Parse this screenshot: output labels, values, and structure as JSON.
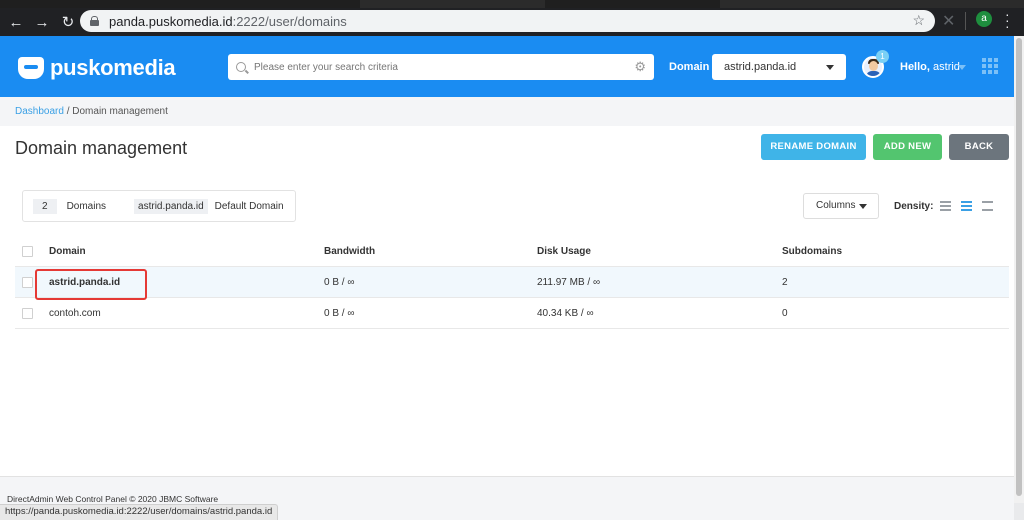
{
  "browser": {
    "url_host": "panda.puskomedia.id",
    "url_rest": ":2222/user/domains",
    "profile_initial": "a"
  },
  "header": {
    "logo_text": "puskomedia",
    "search_placeholder": "Please enter your search criteria",
    "domain_label": "Domain",
    "domain_selected": "astrid.panda.id",
    "notification_count": "1",
    "hello_prefix": "Hello,",
    "username": "astrid",
    "brand_color": "#1a8cf2"
  },
  "breadcrumb": {
    "root": "Dashboard",
    "separator": "/",
    "current": "Domain management"
  },
  "page": {
    "title": "Domain management",
    "buttons": {
      "rename": "RENAME DOMAIN",
      "add_new": "ADD NEW",
      "back": "BACK"
    }
  },
  "summary": {
    "count": "2",
    "count_label": "Domains",
    "default_domain": "astrid.panda.id",
    "default_label": "Default Domain"
  },
  "controls": {
    "columns_label": "Columns",
    "density_label": "Density:"
  },
  "table": {
    "headers": [
      "Domain",
      "Bandwidth",
      "Disk Usage",
      "Subdomains"
    ],
    "rows": [
      {
        "domain": "astrid.panda.id",
        "bandwidth": "0 B / ∞",
        "disk": "211.97 MB / ∞",
        "subdomains": "2"
      },
      {
        "domain": "contoh.com",
        "bandwidth": "0 B / ∞",
        "disk": "40.34 KB / ∞",
        "subdomains": "0"
      }
    ]
  },
  "footer": {
    "text": "DirectAdmin Web Control Panel © 2020 JBMC Software"
  },
  "status_bar": {
    "hover_url": "https://panda.puskomedia.id:2222/user/domains/astrid.panda.id"
  }
}
